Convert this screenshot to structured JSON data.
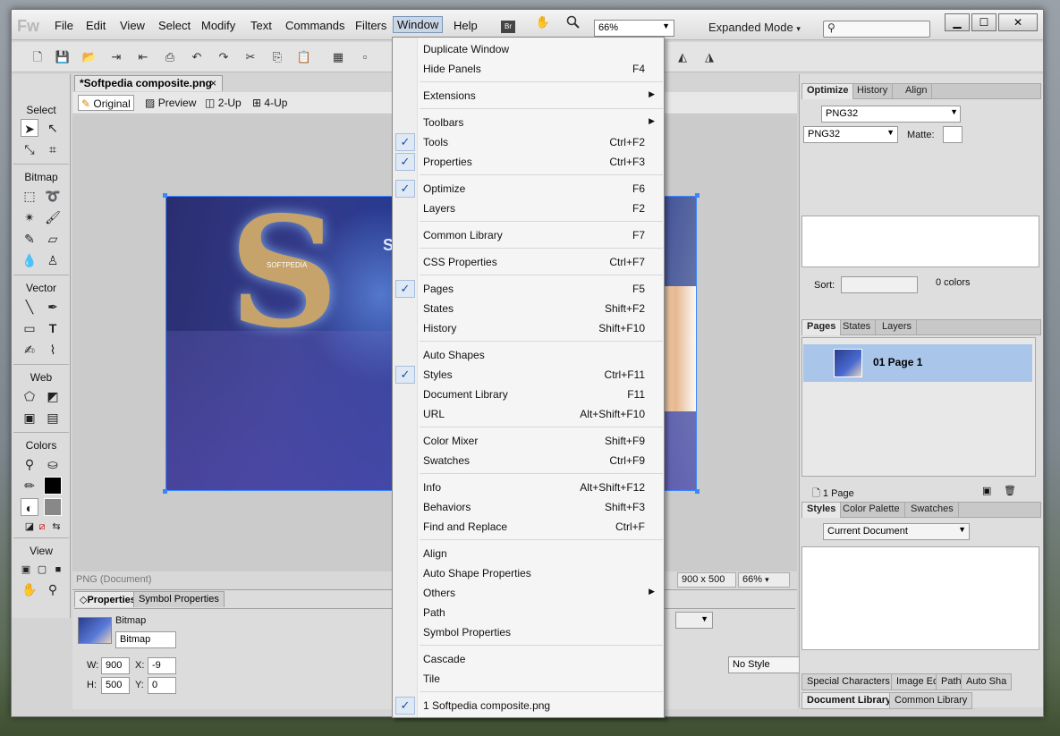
{
  "menubar": {
    "logo": "Fw",
    "items": [
      "File",
      "Edit",
      "View",
      "Select",
      "Modify",
      "Text",
      "Commands",
      "Filters",
      "Window",
      "Help"
    ],
    "bridge_label": "Br",
    "zoom_value": "66%",
    "mode": "Expanded Mode",
    "search_placeholder": "",
    "win_minimize": "▁",
    "win_maximize": "☐",
    "win_close": "✕"
  },
  "document": {
    "tab_title": "*Softpedia composite.png",
    "tab_close": "×",
    "view_buttons": [
      "Original",
      "Preview",
      "2-Up",
      "4-Up"
    ],
    "status_type": "PNG (Document)",
    "canvas_size": "900 x 500",
    "canvas_zoom": "66%",
    "artwork_title": "So",
    "artwork_logo": "SOFTPEDIA"
  },
  "tools": {
    "sections": [
      "Select",
      "Bitmap",
      "Vector",
      "Web",
      "Colors",
      "View"
    ]
  },
  "properties": {
    "tabs": [
      "Properties",
      "Symbol Properties"
    ],
    "object_type": "Bitmap",
    "object_name": "Bitmap",
    "w_label": "W:",
    "w_value": "900",
    "h_label": "H:",
    "h_value": "500",
    "x_label": "X:",
    "x_value": "-9",
    "y_label": "Y:",
    "y_value": "0",
    "style_value": "No Style"
  },
  "right_panel": {
    "top_tabs": [
      "Optimize",
      "History",
      "Align"
    ],
    "format_top": "PNG32",
    "format": "PNG32",
    "matte_label": "Matte:",
    "sort_label": "Sort:",
    "colors_count": "0 colors",
    "pages_tabs": [
      "Pages",
      "States",
      "Layers"
    ],
    "page_item": "01 Page 1",
    "page_count": "1 Page",
    "styles_tabs": [
      "Styles",
      "Color Palette",
      "Swatches"
    ],
    "styles_select": "Current Document",
    "bottom_tabs_1": [
      "Special Characters",
      "Image Ed",
      "Path",
      "Auto Sha"
    ],
    "bottom_tabs_2": [
      "Document Library",
      "Common Library"
    ]
  },
  "window_menu": [
    {
      "label": "Duplicate Window",
      "shortcut": "",
      "checked": false,
      "submenu": false
    },
    {
      "label": "Hide Panels",
      "shortcut": "F4",
      "checked": false,
      "submenu": false
    },
    {
      "sep": true
    },
    {
      "label": "Extensions",
      "shortcut": "",
      "checked": false,
      "submenu": true
    },
    {
      "sep": true
    },
    {
      "label": "Toolbars",
      "shortcut": "",
      "checked": false,
      "submenu": true
    },
    {
      "label": "Tools",
      "shortcut": "Ctrl+F2",
      "checked": true,
      "submenu": false
    },
    {
      "label": "Properties",
      "shortcut": "Ctrl+F3",
      "checked": true,
      "submenu": false
    },
    {
      "sep": true
    },
    {
      "label": "Optimize",
      "shortcut": "F6",
      "checked": true,
      "submenu": false
    },
    {
      "label": "Layers",
      "shortcut": "F2",
      "checked": false,
      "submenu": false
    },
    {
      "sep": true
    },
    {
      "label": "Common Library",
      "shortcut": "F7",
      "checked": false,
      "submenu": false
    },
    {
      "sep": true
    },
    {
      "label": "CSS Properties",
      "shortcut": "Ctrl+F7",
      "checked": false,
      "submenu": false
    },
    {
      "sep": true
    },
    {
      "label": "Pages",
      "shortcut": "F5",
      "checked": true,
      "submenu": false
    },
    {
      "label": "States",
      "shortcut": "Shift+F2",
      "checked": false,
      "submenu": false
    },
    {
      "label": "History",
      "shortcut": "Shift+F10",
      "checked": false,
      "submenu": false
    },
    {
      "sep": true
    },
    {
      "label": "Auto Shapes",
      "shortcut": "",
      "checked": false,
      "submenu": false
    },
    {
      "label": "Styles",
      "shortcut": "Ctrl+F11",
      "checked": true,
      "submenu": false
    },
    {
      "label": "Document Library",
      "shortcut": "F11",
      "checked": false,
      "submenu": false
    },
    {
      "label": "URL",
      "shortcut": "Alt+Shift+F10",
      "checked": false,
      "submenu": false
    },
    {
      "sep": true
    },
    {
      "label": "Color Mixer",
      "shortcut": "Shift+F9",
      "checked": false,
      "submenu": false
    },
    {
      "label": "Swatches",
      "shortcut": "Ctrl+F9",
      "checked": false,
      "submenu": false
    },
    {
      "sep": true
    },
    {
      "label": "Info",
      "shortcut": "Alt+Shift+F12",
      "checked": false,
      "submenu": false
    },
    {
      "label": "Behaviors",
      "shortcut": "Shift+F3",
      "checked": false,
      "submenu": false
    },
    {
      "label": "Find and Replace",
      "shortcut": "Ctrl+F",
      "checked": false,
      "submenu": false
    },
    {
      "sep": true
    },
    {
      "label": "Align",
      "shortcut": "",
      "checked": false,
      "submenu": false
    },
    {
      "label": "Auto Shape Properties",
      "shortcut": "",
      "checked": false,
      "submenu": false
    },
    {
      "label": "Others",
      "shortcut": "",
      "checked": false,
      "submenu": true
    },
    {
      "label": "Path",
      "shortcut": "",
      "checked": false,
      "submenu": false
    },
    {
      "label": "Symbol Properties",
      "shortcut": "",
      "checked": false,
      "submenu": false
    },
    {
      "sep": true
    },
    {
      "label": "Cascade",
      "shortcut": "",
      "checked": false,
      "submenu": false
    },
    {
      "label": "Tile",
      "shortcut": "",
      "checked": false,
      "submenu": false
    },
    {
      "sep": true
    },
    {
      "label": "1 Softpedia composite.png",
      "shortcut": "",
      "checked": true,
      "submenu": false
    }
  ],
  "colors": {
    "accent": "#3a86ff",
    "menu_highlight": "#c8d6e6",
    "page_selected": "#a9c6ea"
  }
}
